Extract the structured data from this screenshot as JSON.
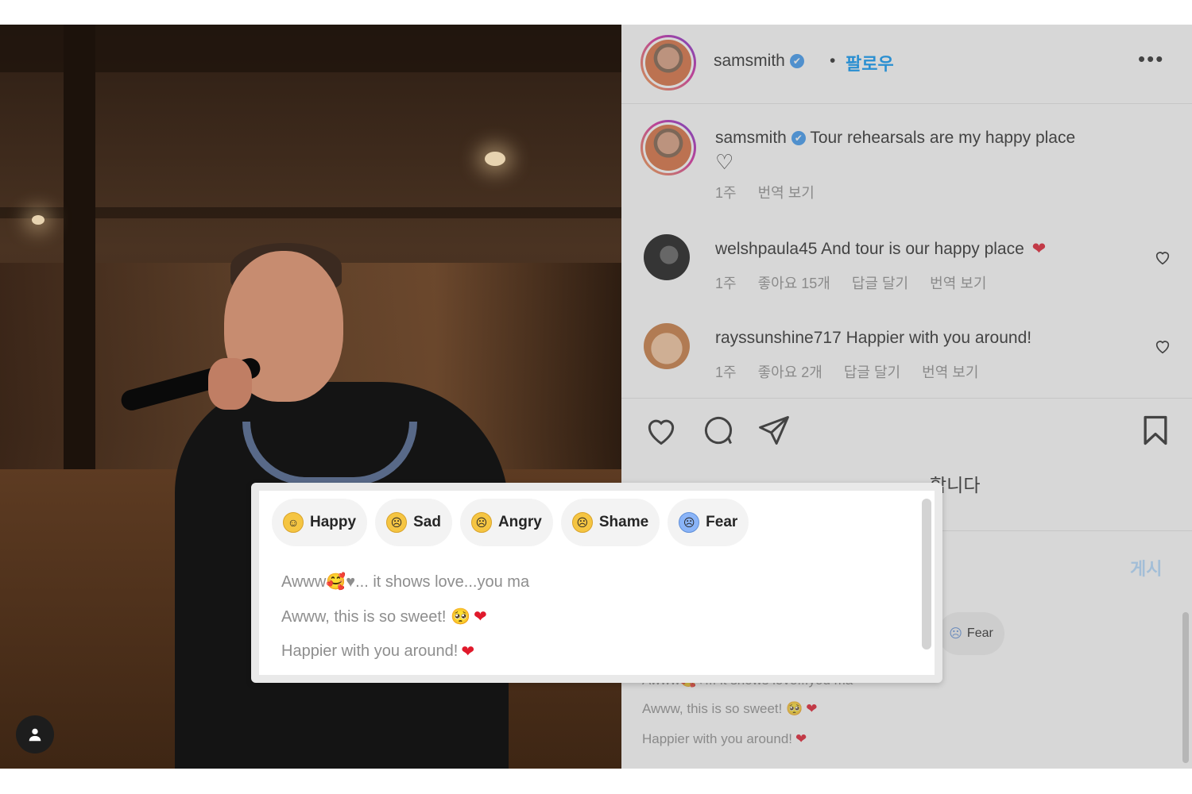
{
  "post": {
    "username": "samsmith",
    "verified_mark": "✔",
    "separator": "•",
    "follow_label": "팔로우",
    "more_label": "•••"
  },
  "caption": {
    "username": "samsmith",
    "text": "Tour rehearsals are my happy place",
    "heart": "♡",
    "time": "1주",
    "translate": "번역 보기"
  },
  "comments": [
    {
      "username": "welshpaula45",
      "text": "And tour is our happy place",
      "heart": "❤",
      "time": "1주",
      "likes": "좋아요 15개",
      "reply": "답글 달기",
      "translate": "번역 보기"
    },
    {
      "username": "rayssunshine717",
      "text": "Happier with you around!",
      "time": "1주",
      "likes": "좋아요 2개",
      "reply": "답글 달기",
      "translate": "번역 보기"
    }
  ],
  "actions": {
    "likes_text": "합니다"
  },
  "comment_box": {
    "post_label": "게시"
  },
  "emotion_popup": {
    "chips": [
      {
        "label": "Happy",
        "emoji": "☺"
      },
      {
        "label": "Sad",
        "emoji": "☹"
      },
      {
        "label": "Angry",
        "emoji": "☹"
      },
      {
        "label": "Shame",
        "emoji": "☹"
      },
      {
        "label": "Fear",
        "emoji": "☹"
      }
    ],
    "suggestions": [
      {
        "text": "Awww🥰♥... it shows love...you ma",
        "tail": ""
      },
      {
        "text": "Awww, this is so sweet! 🥺",
        "tail": "❤"
      },
      {
        "text": "Happier with you around!",
        "tail": "❤"
      }
    ]
  },
  "background_popup": {
    "chips": [
      {
        "label": "me"
      },
      {
        "label": "Fear",
        "emoji": "☹"
      }
    ],
    "suggestions": [
      {
        "text": "Awww🥰♥... it shows love...you ma",
        "tail": ""
      },
      {
        "text": "Awww, this is so sweet! 🥺",
        "tail": "❤"
      },
      {
        "text": "Happier with you around!",
        "tail": "❤"
      }
    ]
  },
  "colors": {
    "link_blue": "#0095f6",
    "heart_red": "#e0192b",
    "muted_text": "#8e8e8e"
  }
}
